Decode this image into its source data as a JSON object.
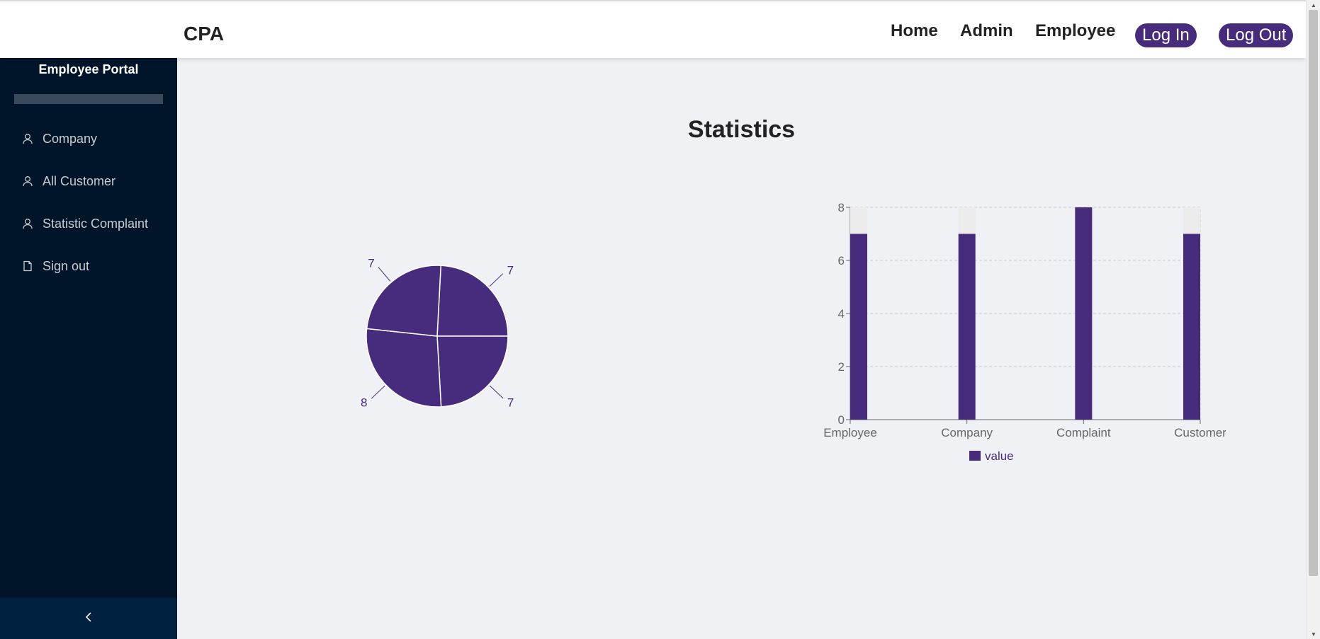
{
  "app": {
    "brand": "CPA"
  },
  "nav": {
    "home": "Home",
    "admin": "Admin",
    "employee": "Employee",
    "login": "Log In",
    "logout": "Log Out"
  },
  "sidebar": {
    "title": "Employee Portal",
    "items": [
      {
        "label": "Company",
        "icon": "user-icon"
      },
      {
        "label": "All Customer",
        "icon": "user-icon"
      },
      {
        "label": "Statistic Complaint",
        "icon": "user-icon"
      },
      {
        "label": "Sign out",
        "icon": "file-icon"
      }
    ],
    "collapse_icon": "chevron-left-icon"
  },
  "main": {
    "title": "Statistics"
  },
  "colors": {
    "accent": "#472b7c",
    "sidebar": "#001529",
    "background": "#f0f1f5"
  },
  "chart_data": [
    {
      "type": "pie",
      "slices": [
        {
          "label": "7",
          "value": 7
        },
        {
          "label": "7",
          "value": 7
        },
        {
          "label": "8",
          "value": 8
        },
        {
          "label": "7",
          "value": 7
        }
      ]
    },
    {
      "type": "bar",
      "categories": [
        "Employee",
        "Company",
        "Complaint",
        "Customer"
      ],
      "series": [
        {
          "name": "value",
          "values": [
            7,
            7,
            8,
            7
          ]
        }
      ],
      "ylim": [
        0,
        8
      ],
      "yticks": [
        0,
        2,
        4,
        6,
        8
      ],
      "grid": true,
      "legend": "bottom"
    }
  ]
}
